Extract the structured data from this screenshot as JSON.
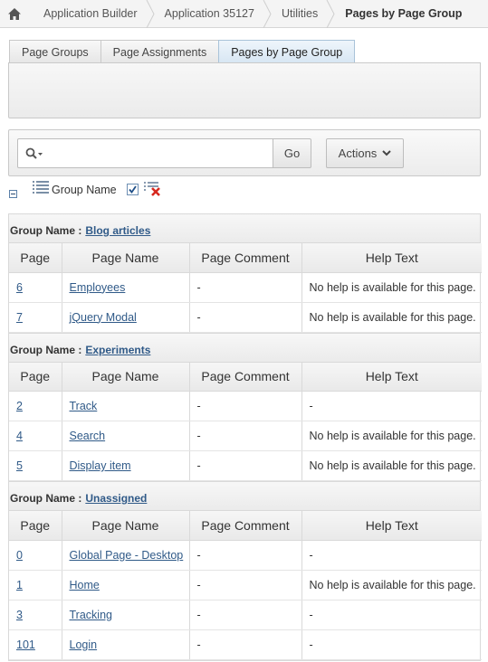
{
  "breadcrumb": {
    "items": [
      "Application Builder",
      "Application 35127",
      "Utilities"
    ],
    "current": "Pages by Page Group"
  },
  "tabs": [
    {
      "label": "Page Groups",
      "active": false
    },
    {
      "label": "Page Assignments",
      "active": false
    },
    {
      "label": "Pages by Page Group",
      "active": true
    }
  ],
  "search": {
    "value": "",
    "go_label": "Go",
    "actions_label": "Actions"
  },
  "control_break": {
    "label": "Group Name",
    "checked": true
  },
  "report": {
    "group_prefix": "Group Name :",
    "columns": [
      "Page",
      "Page Name",
      "Page Comment",
      "Help Text"
    ],
    "groups": [
      {
        "name": "Blog articles",
        "rows": [
          {
            "page": "6",
            "name": "Employees",
            "comment": "-",
            "help": "No help is available for this page."
          },
          {
            "page": "7",
            "name": "jQuery Modal",
            "comment": "-",
            "help": "No help is available for this page."
          }
        ]
      },
      {
        "name": "Experiments",
        "rows": [
          {
            "page": "2",
            "name": "Track",
            "comment": "-",
            "help": "-"
          },
          {
            "page": "4",
            "name": "Search",
            "comment": "-",
            "help": "No help is available for this page."
          },
          {
            "page": "5",
            "name": "Display item",
            "comment": "-",
            "help": "No help is available for this page."
          }
        ]
      },
      {
        "name": "Unassigned",
        "rows": [
          {
            "page": "0",
            "name": "Global Page - Desktop",
            "comment": "-",
            "help": "-"
          },
          {
            "page": "1",
            "name": "Home",
            "comment": "-",
            "help": "No help is available for this page."
          },
          {
            "page": "3",
            "name": "Tracking",
            "comment": "-",
            "help": "-"
          },
          {
            "page": "101",
            "name": "Login",
            "comment": "-",
            "help": "-"
          }
        ]
      }
    ]
  },
  "colors": {
    "link": "#305a88",
    "border": "#d9d9d9",
    "active_tab": "#d7e6f3"
  }
}
